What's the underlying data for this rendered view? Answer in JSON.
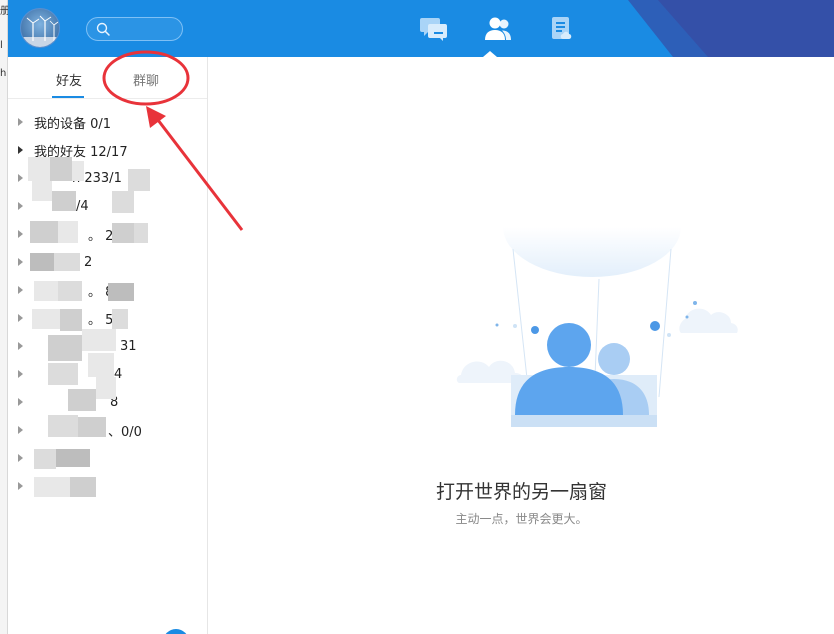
{
  "background_window": {
    "edge_chars": [
      "册",
      "l",
      "h"
    ]
  },
  "header": {
    "search_placeholder": "",
    "nav_icons": [
      "chat-bubbles-icon",
      "contacts-icon",
      "document-icon"
    ],
    "active_nav": "contacts-icon"
  },
  "sidebar": {
    "tabs": [
      {
        "label": "好友",
        "active": true
      },
      {
        "label": "群聊",
        "active": false
      }
    ],
    "groups": [
      {
        "label": "我的设备 0/1"
      },
      {
        "label": "我的好友 12/17"
      },
      {
        "label": "n 233/1"
      },
      {
        "label": "/4"
      },
      {
        "label": "。 2"
      },
      {
        "label": "2"
      },
      {
        "label": "。 8"
      },
      {
        "label": "。 56"
      },
      {
        "label": "31"
      },
      {
        "label": "4"
      },
      {
        "label": "8"
      },
      {
        "label": "、0/0"
      },
      {
        "label": ""
      },
      {
        "label": ""
      }
    ]
  },
  "main": {
    "title": "打开世界的另一扇窗",
    "subtitle": "主动一点，世界会更大。"
  },
  "colors": {
    "header_blue": "#1a8be3",
    "header_dark": "#2d5fb8",
    "accent": "#1a8be3",
    "annotation_red": "#e8333a"
  }
}
